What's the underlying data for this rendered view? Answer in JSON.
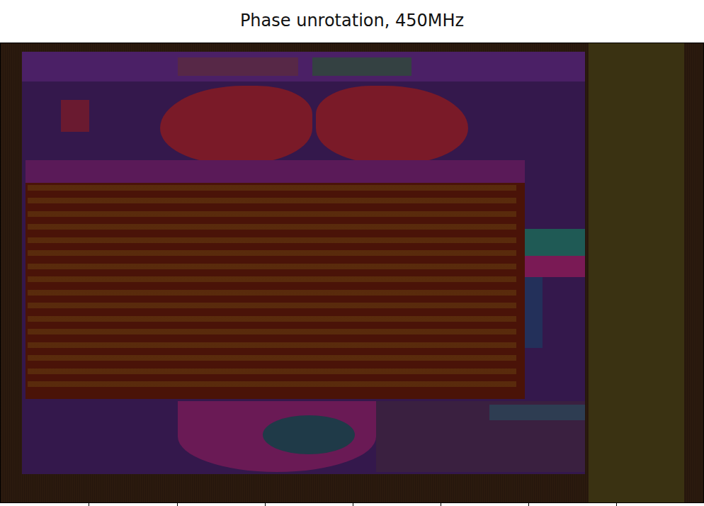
{
  "figure": {
    "title": "Phase unrotation, 450MHz"
  }
}
